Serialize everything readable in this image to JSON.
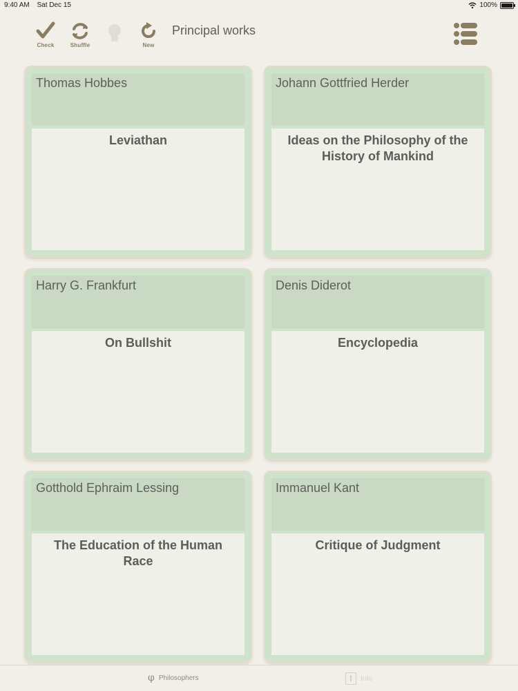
{
  "status_bar": {
    "time": "9:40 AM",
    "date": "Sat Dec 15",
    "battery_text": "100%"
  },
  "toolbar": {
    "title": "Principal works",
    "check_label": "Check",
    "shuffle_label": "Shuffle",
    "new_label": "New",
    "icons": {
      "check": "checkmark-icon",
      "shuffle": "shuffle-icon",
      "hint": "lightbulb-icon",
      "new": "refresh-icon",
      "menu": "list-menu-icon"
    },
    "icon_color": "#8b7d62"
  },
  "cards": [
    {
      "name": "Thomas Hobbes",
      "work": "Leviathan"
    },
    {
      "name": "Johann Gottfried Herder",
      "work": "Ideas on the Philosophy of the History of Mankind"
    },
    {
      "name": "Harry G. Frankfurt",
      "work": "On Bullshit"
    },
    {
      "name": "Denis Diderot",
      "work": "Encyclopedia"
    },
    {
      "name": "Gotthold Ephraim Lessing",
      "work": "The Education of the Human Race"
    },
    {
      "name": "Immanuel Kant",
      "work": "Critique of Judgment"
    }
  ],
  "tabbar": {
    "philosophers_label": "Philosophers",
    "info_label": "Info",
    "philosophers_icon": "φ"
  },
  "colors": {
    "background": "#f2efe8",
    "card_frame": "#cfe3cc",
    "card_header": "#cad9c4",
    "card_body": "#f0efe8",
    "text": "#5c5c59"
  }
}
